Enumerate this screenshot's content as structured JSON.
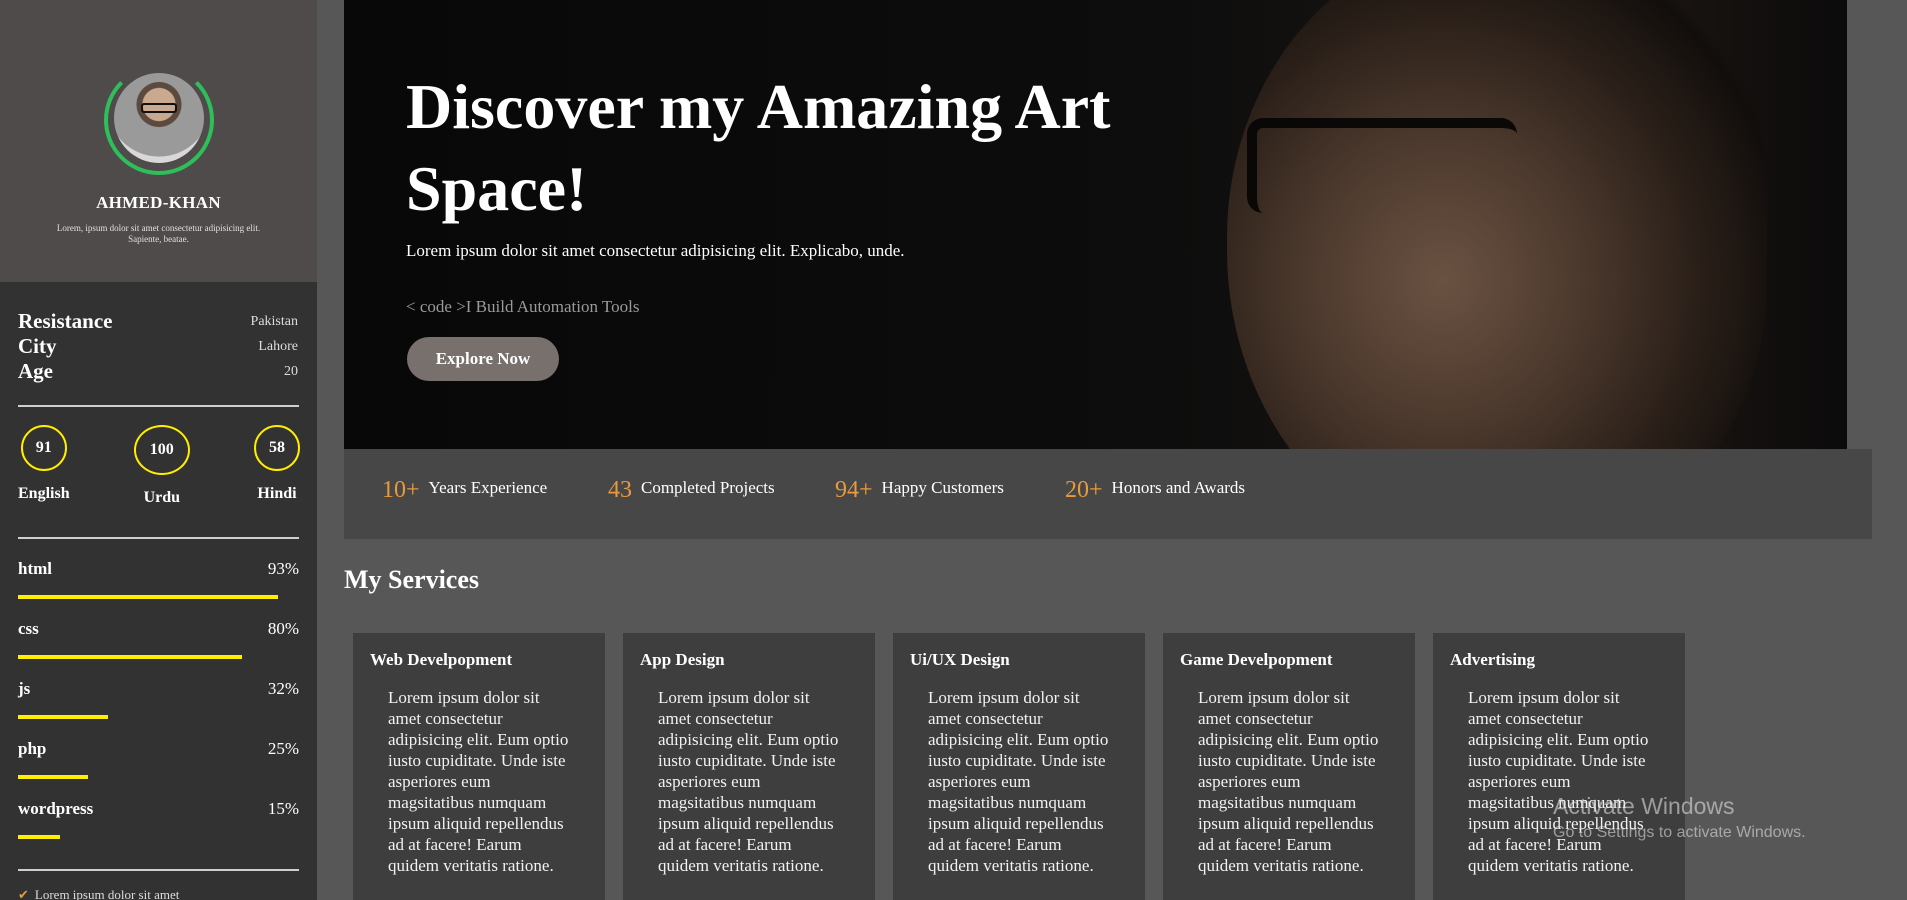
{
  "profile": {
    "name": "AHMED-KHAN",
    "bio": "Lorem, ipsum dolor sit amet consectetur adipisicing elit. Sapiente, beatae."
  },
  "info": {
    "labels": [
      "Resistance",
      "City",
      "Age"
    ],
    "values": [
      "Pakistan",
      "Lahore",
      "20"
    ]
  },
  "languages": [
    {
      "value": "91",
      "name": "English"
    },
    {
      "value": "100",
      "name": "Urdu"
    },
    {
      "value": "58",
      "name": "Hindi"
    }
  ],
  "skills": [
    {
      "name": "html",
      "percent": "93%",
      "level": 0.93
    },
    {
      "name": "css",
      "percent": "80%",
      "level": 0.8
    },
    {
      "name": "js",
      "percent": "32%",
      "level": 0.32
    },
    {
      "name": "php",
      "percent": "25%",
      "level": 0.25
    },
    {
      "name": "wordpress",
      "percent": "15%",
      "level": 0.15
    }
  ],
  "sidebar_footer": "Lorem ipsum dolor sit amet",
  "hero": {
    "title": "Discover my Amazing Art Space!",
    "subtitle": "Lorem ipsum dolor sit amet consectetur adipisicing elit. Explicabo, unde.",
    "code_line": "< code >I Build Automation Tools",
    "button": "Explore Now"
  },
  "stats": [
    {
      "number": "10+",
      "label": "Years Experience"
    },
    {
      "number": "43",
      "label": "Completed Projects"
    },
    {
      "number": "94+",
      "label": "Happy Customers"
    },
    {
      "number": "20+",
      "label": "Honors and Awards"
    }
  ],
  "services": {
    "title": "My Services",
    "cards": [
      {
        "title": "Web Develpopment",
        "text": "Lorem ipsum dolor sit amet consectetur adipisicing elit. Eum optio iusto cupiditate. Unde iste asperiores eum magsitatibus numquam ipsum aliquid repellendus ad at facere! Earum quidem veritatis ratione."
      },
      {
        "title": "App Design",
        "text": "Lorem ipsum dolor sit amet consectetur adipisicing elit. Eum optio iusto cupiditate. Unde iste asperiores eum magsitatibus numquam ipsum aliquid repellendus ad at facere! Earum quidem veritatis ratione."
      },
      {
        "title": "Ui/UX Design",
        "text": "Lorem ipsum dolor sit amet consectetur adipisicing elit. Eum optio iusto cupiditate. Unde iste asperiores eum magsitatibus numquam ipsum aliquid repellendus ad at facere! Earum quidem veritatis ratione."
      },
      {
        "title": "Game Develpopment",
        "text": "Lorem ipsum dolor sit amet consectetur adipisicing elit. Eum optio iusto cupiditate. Unde iste asperiores eum magsitatibus numquam ipsum aliquid repellendus ad at facere! Earum quidem veritatis ratione."
      },
      {
        "title": "Advertising",
        "text": "Lorem ipsum dolor sit amet consectetur adipisicing elit. Eum optio iusto cupiditate. Unde iste asperiores eum magsitatibus numquam ipsum aliquid repellendus ad at facere! Earum quidem veritatis ratione."
      }
    ]
  },
  "watermark": {
    "title": "Activate Windows",
    "subtitle": "Go to Settings to activate Windows."
  },
  "colors": {
    "accent_orange": "#e89a3c",
    "skill_yellow": "#ffee00",
    "avatar_ring_green": "#2fbf5a",
    "button_bg": "#77706c"
  },
  "icons": {
    "sidebar_footer": "check-icon"
  }
}
